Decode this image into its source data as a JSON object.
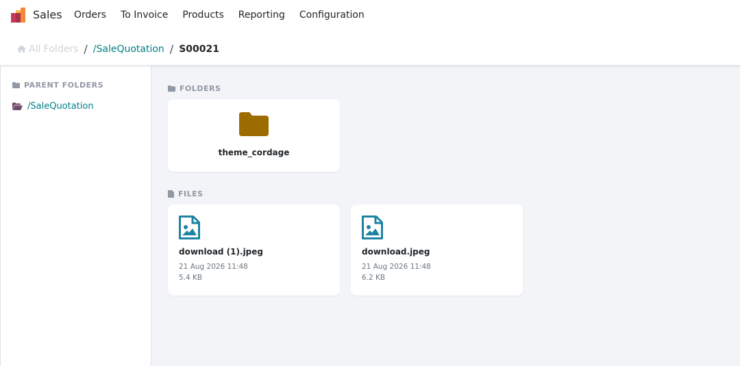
{
  "navbar": {
    "app_name": "Sales",
    "app_icon": "sales-app-logo-icon",
    "menu": [
      "Orders",
      "To Invoice",
      "Products",
      "Reporting",
      "Configuration"
    ]
  },
  "breadcrumb": {
    "home_icon": "home-icon",
    "home": "All Folders",
    "separator": "/",
    "parent": "/SaleQuotation",
    "current": "S00021"
  },
  "sidebar": {
    "title": "PARENT FOLDERS",
    "title_icon": "folder-icon",
    "items": [
      {
        "label": "/SaleQuotation",
        "icon": "folder-open-icon"
      }
    ]
  },
  "main": {
    "folders_title": "FOLDERS",
    "folders_icon": "folder-icon",
    "folders": [
      {
        "name": "theme_cordage",
        "icon": "folder-icon",
        "color": "#9c6c00"
      }
    ],
    "files_title": "FILES",
    "files_icon": "file-icon",
    "files": [
      {
        "name": "download (1).jpeg",
        "date": "21 Aug 2026 11:48",
        "size": "5.4 KB",
        "icon": "image-file-icon"
      },
      {
        "name": "download.jpeg",
        "date": "21 Aug 2026 11:48",
        "size": "6.2 KB",
        "icon": "image-file-icon"
      }
    ]
  },
  "colors": {
    "link": "#017e84",
    "file_icon": "#1d82a4",
    "folder": "#9c6c00",
    "parent_folder_icon": "#714b67",
    "background": "#f3f4f8"
  }
}
